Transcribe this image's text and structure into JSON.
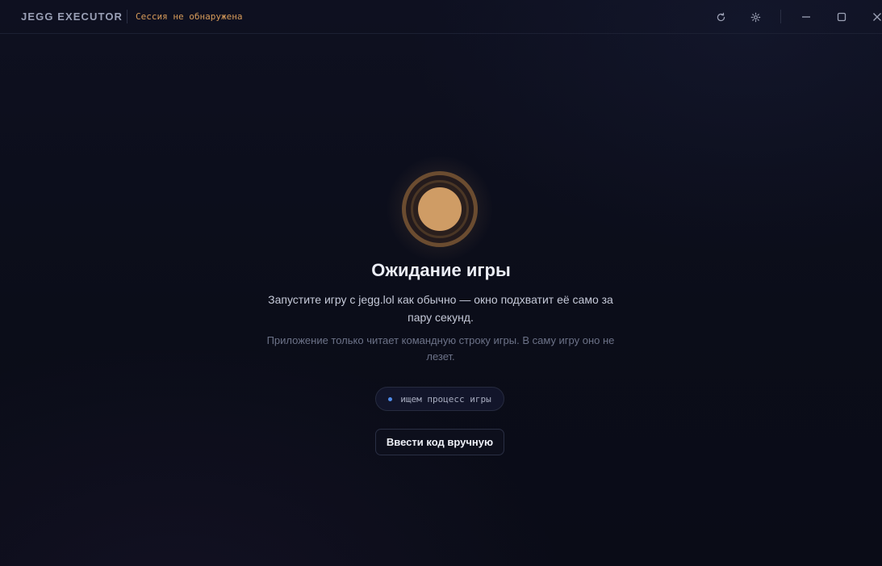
{
  "app": {
    "title": "JEGG EXECUTOR",
    "session_status": "Сессия не обнаружена"
  },
  "titlebar": {
    "icons": [
      "refresh-icon",
      "settings-gear-icon",
      "minimize-icon",
      "maximize-icon",
      "close-icon"
    ]
  },
  "main": {
    "heading": "Ожидание игры",
    "description": "Запустите игру с jegg.lol как обычно — окно подхватит её само за пару секунд.",
    "note": "Приложение только читает командную строку игры. В саму игру оно не лезет.",
    "status_text": "ищем процесс игры",
    "manual_button_label": "Ввести код вручную"
  },
  "colors": {
    "accent_orange": "#d79b5a",
    "orb_core": "#cf9c65",
    "status_dot_blue": "#4f8be8",
    "background": "#0b0d18"
  }
}
